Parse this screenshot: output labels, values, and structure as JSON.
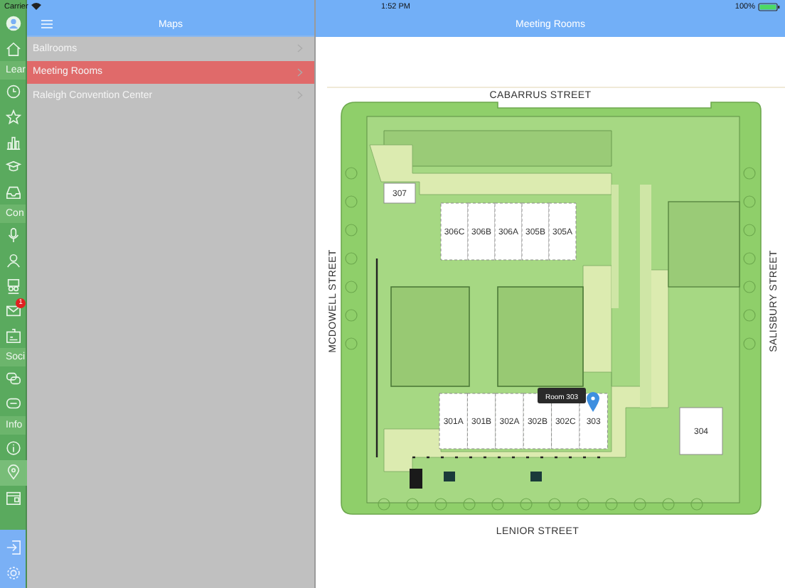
{
  "status_bar": {
    "carrier": "Carrier",
    "time": "1:52 PM",
    "battery": "100%"
  },
  "rail": {
    "items": [
      {
        "kind": "avatar",
        "selected": false
      },
      {
        "kind": "home",
        "selected": false
      },
      {
        "kind": "section",
        "label": "Lear"
      },
      {
        "kind": "clock",
        "selected": false
      },
      {
        "kind": "star",
        "selected": false
      },
      {
        "kind": "chart",
        "selected": false
      },
      {
        "kind": "cap",
        "selected": false
      },
      {
        "kind": "inbox",
        "selected": false
      },
      {
        "kind": "section",
        "label": "Con"
      },
      {
        "kind": "mic",
        "selected": false
      },
      {
        "kind": "person",
        "selected": false
      },
      {
        "kind": "people",
        "selected": false
      },
      {
        "kind": "mail",
        "selected": false,
        "badge": "1"
      },
      {
        "kind": "card",
        "selected": false
      },
      {
        "kind": "section",
        "label": "Soci"
      },
      {
        "kind": "chats",
        "selected": false
      },
      {
        "kind": "message",
        "selected": false
      },
      {
        "kind": "section",
        "label": "Info"
      },
      {
        "kind": "info",
        "selected": false
      },
      {
        "kind": "pin",
        "selected": true
      },
      {
        "kind": "calendar",
        "selected": false
      }
    ],
    "bottom": [
      {
        "kind": "logout"
      },
      {
        "kind": "gear"
      }
    ]
  },
  "master": {
    "title": "Maps",
    "items": [
      {
        "label": "Ballrooms",
        "selected": false
      },
      {
        "label": "Meeting Rooms",
        "selected": true
      },
      {
        "label": "Raleigh Convention Center",
        "selected": false
      }
    ]
  },
  "detail": {
    "title": "Meeting Rooms"
  },
  "map": {
    "streets": [
      {
        "kind": "top",
        "label": "CABARRUS STREET"
      },
      {
        "kind": "left",
        "label": "MCDOWELL STREET"
      },
      {
        "kind": "right",
        "label": "SALISBURY STREET"
      },
      {
        "kind": "bottom",
        "label": "LENIOR STREET"
      }
    ],
    "rooms": [
      {
        "label": "307"
      },
      {
        "label": "306C"
      },
      {
        "label": "306B"
      },
      {
        "label": "306A"
      },
      {
        "label": "305B"
      },
      {
        "label": "305A"
      },
      {
        "label": "301A"
      },
      {
        "label": "301B"
      },
      {
        "label": "302A"
      },
      {
        "label": "302B"
      },
      {
        "label": "302C"
      },
      {
        "label": "303"
      },
      {
        "label": "304"
      }
    ],
    "tooltip": "Room 303"
  }
}
